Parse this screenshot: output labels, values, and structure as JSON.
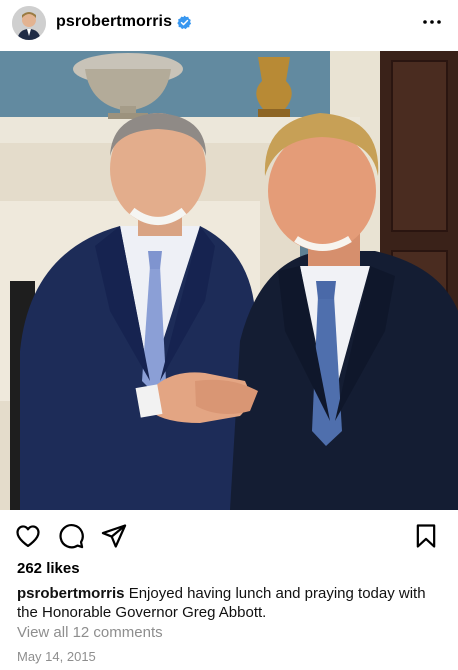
{
  "post": {
    "username": "psrobertmorris",
    "verified": true,
    "likes": "262 likes",
    "caption_user": "psrobertmorris",
    "caption_text": "Enjoyed having lunch and praying today with the Honorable Governor Greg Abbott.",
    "comments_link": "View all 12 comments",
    "date": "May 14, 2015"
  },
  "icons": {
    "more": "more-options-icon",
    "like": "heart-icon",
    "comment": "comment-bubble-icon",
    "share": "paper-plane-icon",
    "save": "bookmark-icon",
    "verified": "verified-badge-icon"
  },
  "colors": {
    "verified": "#3897f0",
    "secondary_text": "#8e8e8e"
  }
}
